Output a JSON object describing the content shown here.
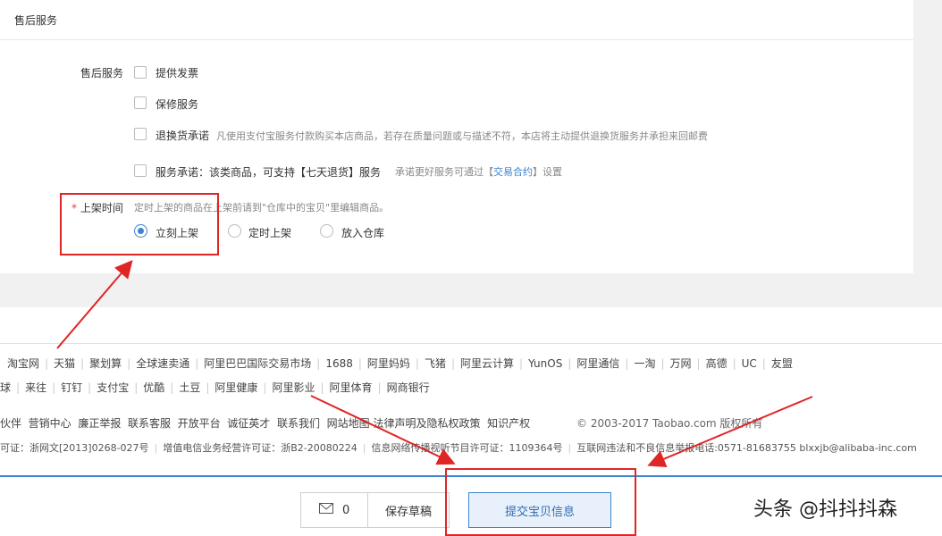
{
  "section": {
    "title": "售后服务"
  },
  "after_sales": {
    "label": "售后服务",
    "options": [
      {
        "label": "提供发票",
        "checked": false
      },
      {
        "label": "保修服务",
        "checked": false
      },
      {
        "label": "退换货承诺",
        "checked": false,
        "hint": "凡使用支付宝服务付款购买本店商品，若存在质量问题或与描述不符，本店将主动提供退换货服务并承担来回邮费"
      },
      {
        "label": "服务承诺：该类商品，可支持【七天退货】服务",
        "checked": false,
        "hint_pre": "承诺更好服务可通过【",
        "hint_link": "交易合约",
        "hint_post": "】设置"
      }
    ]
  },
  "listing": {
    "required_mark": "*",
    "label": "上架时间",
    "hint": "定时上架的商品在上架前请到\"仓库中的宝贝\"里编辑商品。",
    "options": [
      {
        "label": "立刻上架",
        "selected": true
      },
      {
        "label": "定时上架",
        "selected": false
      },
      {
        "label": "放入仓库",
        "selected": false
      }
    ]
  },
  "footer": {
    "links_row1": [
      "淘宝网",
      "天猫",
      "聚划算",
      "全球速卖通",
      "阿里巴巴国际交易市场",
      "1688",
      "阿里妈妈",
      "飞猪",
      "阿里云计算",
      "YunOS",
      "阿里通信",
      "一淘",
      "万网",
      "高德",
      "UC",
      "友盟"
    ],
    "links_row2": [
      "球",
      "来往",
      "钉钉",
      "支付宝",
      "优酷",
      "土豆",
      "阿里健康",
      "阿里影业",
      "阿里体育",
      "网商银行"
    ],
    "links_row3": [
      "伙伴",
      "营销中心",
      "廉正举报",
      "联系客服",
      "开放平台",
      "诚征英才",
      "联系我们",
      "网站地图",
      "法律声明及隐私权政策",
      "知识产权"
    ],
    "copyright": "© 2003-2017 Taobao.com 版权所有",
    "license_items": [
      "可证：浙网文[2013]0268-027号",
      "增值电信业务经营许可证：浙B2-20080224",
      "信息网络传播视听节目许可证：1109364号",
      "互联网违法和不良信息举报电话:0571-81683755 blxxjb@alibaba-inc.com"
    ]
  },
  "actions": {
    "message_count": "0",
    "save_draft": "保存草稿",
    "submit": "提交宝贝信息"
  },
  "watermark": "头条 @抖抖抖森",
  "colors": {
    "accent": "#3a84d1",
    "annotation_red": "#e02525",
    "required": "#e4393c"
  }
}
